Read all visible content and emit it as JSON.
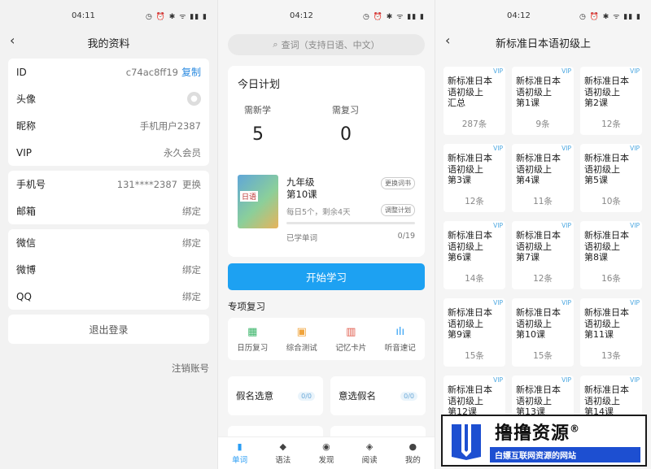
{
  "profile": {
    "time": "04:11",
    "status_icons": "◷ ⏰ ✱ ᯤ ▮▮ ▮",
    "title": "我的资料",
    "rows_a": [
      {
        "label": "ID",
        "value": "c74ac8ff19",
        "link": "复制"
      },
      {
        "label": "头像",
        "value": ""
      },
      {
        "label": "昵称",
        "value": "手机用户2387"
      },
      {
        "label": "VIP",
        "value": "永久会员"
      }
    ],
    "rows_b": [
      {
        "label": "手机号",
        "value": "131****2387",
        "link": "更换"
      },
      {
        "label": "邮箱",
        "value": "绑定"
      }
    ],
    "rows_c": [
      {
        "label": "微信",
        "value": "绑定"
      },
      {
        "label": "微博",
        "value": "绑定"
      },
      {
        "label": "QQ",
        "value": "绑定"
      }
    ],
    "logout": "退出登录",
    "cancel": "注销账号"
  },
  "home": {
    "time": "04:12",
    "status_icons": "◷ ⏰ ✱ ᯤ ▮▮ ▮",
    "search_placeholder": "查词（支持日语、中文）",
    "plan_title": "今日计划",
    "new_label": "需新学",
    "new_count": "5",
    "review_label": "需复习",
    "review_count": "0",
    "book_tag": "日语",
    "grade": "九年级",
    "lesson": "第10课",
    "change_book": "更换词书",
    "adjust_plan": "调整计划",
    "remain": "每日5个，剩余4天",
    "progress": 0,
    "learned_label": "已学单词",
    "learned_count": "0/19",
    "start": "开始学习",
    "section": "专项复习",
    "reviews": [
      {
        "icon": "calendar-icon",
        "glyph": "▦",
        "label": "日历复习",
        "color": "#3bb56a"
      },
      {
        "icon": "test-icon",
        "glyph": "▣",
        "label": "综合测试",
        "color": "#f0a43c"
      },
      {
        "icon": "card-icon",
        "glyph": "▥",
        "label": "记忆卡片",
        "color": "#e05a4a"
      },
      {
        "icon": "audio-icon",
        "glyph": "ılı",
        "label": "听音速记",
        "color": "#2a9df4"
      }
    ],
    "kana_left": "假名选意",
    "kana_right": "意选假名",
    "kana_badge": "0/0",
    "tabs": [
      {
        "icon": "book-icon",
        "glyph": "▮",
        "label": "单词",
        "active": true
      },
      {
        "icon": "grammar-icon",
        "glyph": "◆",
        "label": "语法",
        "active": false
      },
      {
        "icon": "discover-icon",
        "glyph": "◉",
        "label": "发现",
        "active": false
      },
      {
        "icon": "read-icon",
        "glyph": "◈",
        "label": "阅读",
        "active": false
      },
      {
        "icon": "user-icon",
        "glyph": "●",
        "label": "我的",
        "active": false
      }
    ]
  },
  "book": {
    "time": "04:12",
    "status_icons": "◷ ⏰ ✱ ᯤ ▮▮ ▮",
    "title": "新标准日本语初级上",
    "vip": "VIP",
    "cells": [
      {
        "t1": "新标准日本",
        "t2": "语初级上",
        "t3": "汇总",
        "count": "287条"
      },
      {
        "t1": "新标准日本",
        "t2": "语初级上",
        "t3": "第1课",
        "count": "9条"
      },
      {
        "t1": "新标准日本",
        "t2": "语初级上",
        "t3": "第2课",
        "count": "12条"
      },
      {
        "t1": "新标准日本",
        "t2": "语初级上",
        "t3": "第3课",
        "count": "12条"
      },
      {
        "t1": "新标准日本",
        "t2": "语初级上",
        "t3": "第4课",
        "count": "11条"
      },
      {
        "t1": "新标准日本",
        "t2": "语初级上",
        "t3": "第5课",
        "count": "10条"
      },
      {
        "t1": "新标准日本",
        "t2": "语初级上",
        "t3": "第6课",
        "count": "14条"
      },
      {
        "t1": "新标准日本",
        "t2": "语初级上",
        "t3": "第7课",
        "count": "12条"
      },
      {
        "t1": "新标准日本",
        "t2": "语初级上",
        "t3": "第8课",
        "count": "16条"
      },
      {
        "t1": "新标准日本",
        "t2": "语初级上",
        "t3": "第9课",
        "count": "15条"
      },
      {
        "t1": "新标准日本",
        "t2": "语初级上",
        "t3": "第10课",
        "count": "15条"
      },
      {
        "t1": "新标准日本",
        "t2": "语初级上",
        "t3": "第11课",
        "count": "13条"
      },
      {
        "t1": "新标准日本",
        "t2": "语初级上",
        "t3": "第12课",
        "count": ""
      },
      {
        "t1": "新标准日本",
        "t2": "语初级上",
        "t3": "第13课",
        "count": ""
      },
      {
        "t1": "新标准日本",
        "t2": "语初级上",
        "t3": "第14课",
        "count": ""
      }
    ]
  },
  "watermark": {
    "title": "撸撸资源",
    "reg": "®",
    "subtitle": "白嫖互联网资源的网站"
  }
}
